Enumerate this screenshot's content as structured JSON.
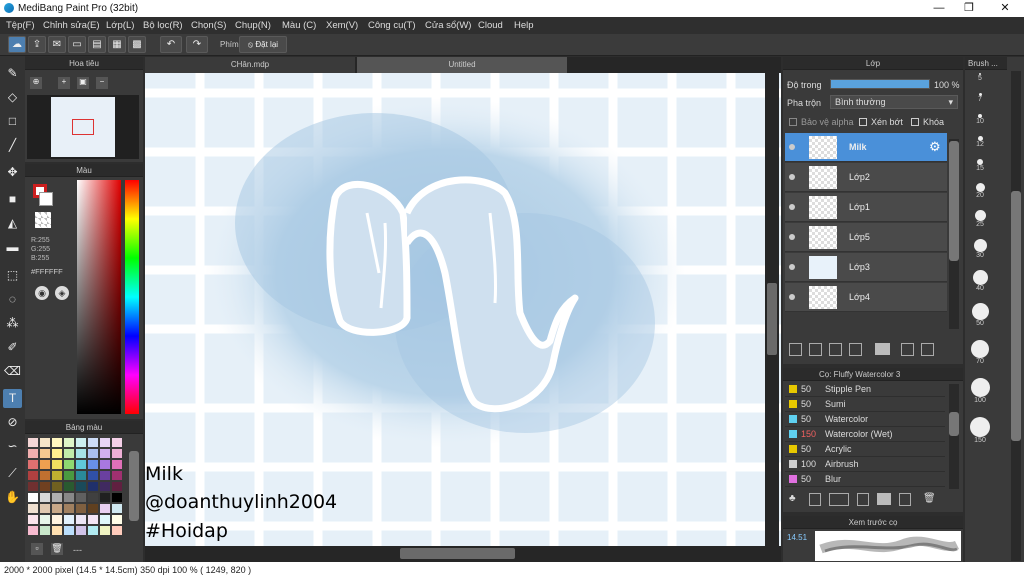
{
  "window": {
    "title": "MediBang Paint Pro (32bit)",
    "minimize": "—",
    "restore": "❐",
    "close": "✕"
  },
  "menu": [
    "Tệp(F)",
    "Chỉnh sửa(E)",
    "Lớp(L)",
    "Bộ lọc(R)",
    "Chọn(S)",
    "Chụp(N)",
    "Màu (C)",
    "Xem(V)",
    "Công cụ(T)",
    "Cửa sổ(W)",
    "Cloud",
    "Help"
  ],
  "toolbar": {
    "key_label": "Phím",
    "reset_label": "Đặt lại"
  },
  "tabs": {
    "left": "CHân.mdp",
    "right": "Untitled"
  },
  "navigator": {
    "title": "Hoa tiêu"
  },
  "color_panel": {
    "title": "Màu",
    "r": "R:255",
    "g": "G:255",
    "b": "B:255",
    "hex": "#FFFFFF",
    "primary": "#cc1f1f",
    "secondary": "#ffffff"
  },
  "palette": {
    "title": "Bảng màu",
    "footer": "---"
  },
  "layers": {
    "title": "Lớp",
    "opacity_label": "Độ trong",
    "opacity_value": "100 %",
    "opacity": 1.0,
    "blend_label": "Pha trộn",
    "blend_value": "Bình thường",
    "protect_alpha": "Bảo vệ alpha",
    "clip": "Xén bớt",
    "lock": "Khóa",
    "items": [
      "Milk",
      "Lớp2",
      "Lớp1",
      "Lớp5",
      "Lớp3",
      "Lớp4"
    ],
    "selected": "Milk"
  },
  "brush_panel": {
    "title": "Cọ: Fluffy Watercolor 3",
    "items": [
      {
        "size": "50",
        "name": "Stipple Pen",
        "color": "#e7c800"
      },
      {
        "size": "50",
        "name": "Sumi",
        "color": "#e7c800"
      },
      {
        "size": "50",
        "name": "Watercolor",
        "color": "#5fd0f0"
      },
      {
        "size": "150",
        "name": "Watercolor (Wet)",
        "color": "#5fd0f0",
        "size_color": "#f06060"
      },
      {
        "size": "50",
        "name": "Acrylic",
        "color": "#e7c800"
      },
      {
        "size": "100",
        "name": "Airbrush",
        "color": "#cfcfcf"
      },
      {
        "size": "50",
        "name": "Blur",
        "color": "#e070e0"
      }
    ]
  },
  "brush_preview": {
    "title": "Xem trước cọ",
    "value": "14.51"
  },
  "brush_sizes": {
    "title": "Brush ...",
    "sizes": [
      "5",
      "7",
      "10",
      "12",
      "15",
      "20",
      "25",
      "30",
      "40",
      "50",
      "70",
      "100",
      "150"
    ]
  },
  "overlay": {
    "line1": "Milk",
    "line2": "@doanthuylinh2004",
    "line3": "#Hoidap"
  },
  "status": "2000 * 2000 pixel   (14.5 * 14.5cm)   350 dpi   100 %   ( 1249, 820 )"
}
